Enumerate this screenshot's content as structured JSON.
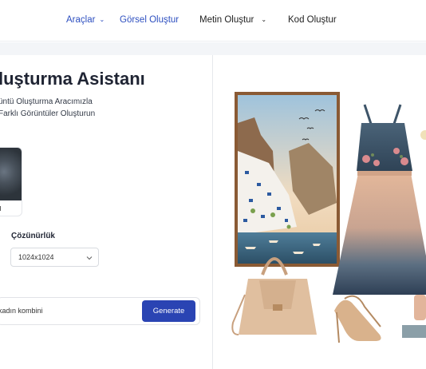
{
  "nav": {
    "tools": "Araçlar",
    "image": "Görsel Oluştur",
    "text": "Metin Oluştur",
    "code": "Kod Oluştur"
  },
  "page": {
    "title": "luşturma Asistanı",
    "subtitle1": "üntü Oluşturma Aracımızla",
    "subtitle2": "Farklı Görüntüler Oluşturun"
  },
  "style_card": {
    "label": "al"
  },
  "resolution": {
    "label": "Çözünürlük",
    "value": "1024x1024"
  },
  "prompt": {
    "value": "kadın kombini",
    "button": "Generate"
  },
  "result_image": {
    "description": "generated-outfit-image"
  }
}
